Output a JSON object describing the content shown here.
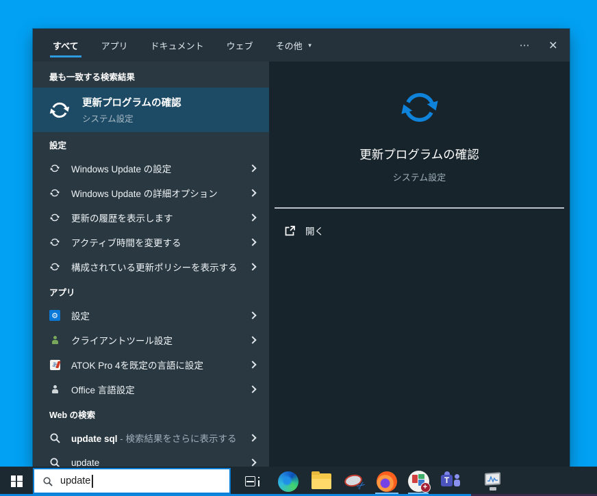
{
  "window": {
    "tabs": [
      {
        "label": "すべて",
        "active": true
      },
      {
        "label": "アプリ",
        "active": false
      },
      {
        "label": "ドキュメント",
        "active": false
      },
      {
        "label": "ウェブ",
        "active": false
      },
      {
        "label": "その他",
        "active": false,
        "has_dropdown": true
      }
    ],
    "dropdown_glyph": "▼",
    "more_label": "⋯",
    "close_label": "×",
    "accent_color": "#2e9bdf"
  },
  "left": {
    "best_match_header": "最も一致する検索結果",
    "best_match": {
      "icon": "sync-icon",
      "title": "更新プログラムの確認",
      "subtitle": "システム設定",
      "highlight_color": "#1d4b66"
    },
    "sections": [
      {
        "header": "設定",
        "items": [
          {
            "icon": "sync-icon",
            "label": "Windows Update の設定"
          },
          {
            "icon": "sync-icon",
            "label": "Windows Update の詳細オプション"
          },
          {
            "icon": "sync-icon",
            "label": "更新の履歴を表示します"
          },
          {
            "icon": "sync-icon",
            "label": "アクティブ時間を変更する"
          },
          {
            "icon": "sync-icon",
            "label": "構成されている更新ポリシーを表示する"
          }
        ]
      },
      {
        "header": "アプリ",
        "items": [
          {
            "icon": "settings-gear-icon",
            "gear_glyph": "⚙",
            "label": "設定"
          },
          {
            "icon": "client-tools-icon",
            "label": "クライアントツール設定"
          },
          {
            "icon": "atok-icon",
            "atok_glyph": "あ",
            "label": "ATOK Pro 4を既定の言語に設定"
          },
          {
            "icon": "office-icon",
            "label": "Office 言語設定"
          }
        ]
      },
      {
        "header": "Web の検索",
        "items": [
          {
            "icon": "search-icon",
            "label": "update sql",
            "suffix": " - 検索結果をさらに表示する"
          },
          {
            "icon": "search-icon",
            "label": "update",
            "suffix": ""
          }
        ]
      }
    ]
  },
  "preview": {
    "icon": "sync-icon",
    "icon_color": "#0f82da",
    "title": "更新プログラムの確認",
    "subtitle": "システム設定",
    "open_label": "開く",
    "open_icon": "open-external-icon"
  },
  "taskbar": {
    "search_value": "update",
    "search_icon": "search-icon",
    "start_icon": "windows-logo",
    "icons": [
      "task-view-icon",
      "edge-icon",
      "file-explorer-icon",
      "snipping-tool-icon",
      "firefox-icon",
      "app-plus-badge-icon",
      "teams-icon",
      "performance-monitor-icon"
    ],
    "running_indicator_color": "#7cc0ef",
    "plus_badge_glyph": "+",
    "teams_glyph": "T"
  }
}
